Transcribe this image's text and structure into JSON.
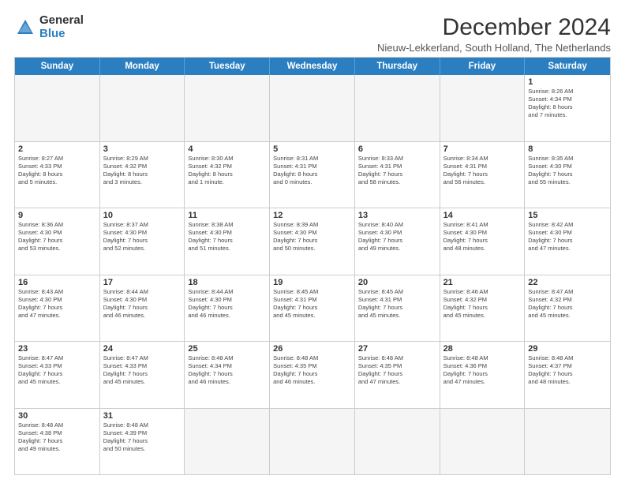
{
  "logo": {
    "general": "General",
    "blue": "Blue"
  },
  "title": "December 2024",
  "subtitle": "Nieuw-Lekkerland, South Holland, The Netherlands",
  "calendar": {
    "headers": [
      "Sunday",
      "Monday",
      "Tuesday",
      "Wednesday",
      "Thursday",
      "Friday",
      "Saturday"
    ],
    "weeks": [
      [
        {
          "day": "",
          "empty": true
        },
        {
          "day": "",
          "empty": true
        },
        {
          "day": "",
          "empty": true
        },
        {
          "day": "",
          "empty": true
        },
        {
          "day": "",
          "empty": true
        },
        {
          "day": "",
          "empty": true
        },
        {
          "day": "1",
          "text": "Sunrise: 8:26 AM\nSunset: 4:34 PM\nDaylight: 8 hours\nand 7 minutes."
        }
      ],
      [
        {
          "day": "2",
          "text": "Sunrise: 8:27 AM\nSunset: 4:33 PM\nDaylight: 8 hours\nand 5 minutes."
        },
        {
          "day": "3",
          "text": "Sunrise: 8:29 AM\nSunset: 4:32 PM\nDaylight: 8 hours\nand 3 minutes."
        },
        {
          "day": "4",
          "text": "Sunrise: 8:30 AM\nSunset: 4:32 PM\nDaylight: 8 hours\nand 1 minute."
        },
        {
          "day": "5",
          "text": "Sunrise: 8:31 AM\nSunset: 4:31 PM\nDaylight: 8 hours\nand 0 minutes."
        },
        {
          "day": "6",
          "text": "Sunrise: 8:33 AM\nSunset: 4:31 PM\nDaylight: 7 hours\nand 58 minutes."
        },
        {
          "day": "7",
          "text": "Sunrise: 8:34 AM\nSunset: 4:31 PM\nDaylight: 7 hours\nand 56 minutes."
        },
        {
          "day": "8",
          "text": "Sunrise: 8:35 AM\nSunset: 4:30 PM\nDaylight: 7 hours\nand 55 minutes."
        }
      ],
      [
        {
          "day": "9",
          "text": "Sunrise: 8:36 AM\nSunset: 4:30 PM\nDaylight: 7 hours\nand 53 minutes."
        },
        {
          "day": "10",
          "text": "Sunrise: 8:37 AM\nSunset: 4:30 PM\nDaylight: 7 hours\nand 52 minutes."
        },
        {
          "day": "11",
          "text": "Sunrise: 8:38 AM\nSunset: 4:30 PM\nDaylight: 7 hours\nand 51 minutes."
        },
        {
          "day": "12",
          "text": "Sunrise: 8:39 AM\nSunset: 4:30 PM\nDaylight: 7 hours\nand 50 minutes."
        },
        {
          "day": "13",
          "text": "Sunrise: 8:40 AM\nSunset: 4:30 PM\nDaylight: 7 hours\nand 49 minutes."
        },
        {
          "day": "14",
          "text": "Sunrise: 8:41 AM\nSunset: 4:30 PM\nDaylight: 7 hours\nand 48 minutes."
        },
        {
          "day": "15",
          "text": "Sunrise: 8:42 AM\nSunset: 4:30 PM\nDaylight: 7 hours\nand 47 minutes."
        }
      ],
      [
        {
          "day": "16",
          "text": "Sunrise: 8:43 AM\nSunset: 4:30 PM\nDaylight: 7 hours\nand 47 minutes."
        },
        {
          "day": "17",
          "text": "Sunrise: 8:44 AM\nSunset: 4:30 PM\nDaylight: 7 hours\nand 46 minutes."
        },
        {
          "day": "18",
          "text": "Sunrise: 8:44 AM\nSunset: 4:30 PM\nDaylight: 7 hours\nand 46 minutes."
        },
        {
          "day": "19",
          "text": "Sunrise: 8:45 AM\nSunset: 4:31 PM\nDaylight: 7 hours\nand 45 minutes."
        },
        {
          "day": "20",
          "text": "Sunrise: 8:45 AM\nSunset: 4:31 PM\nDaylight: 7 hours\nand 45 minutes."
        },
        {
          "day": "21",
          "text": "Sunrise: 8:46 AM\nSunset: 4:32 PM\nDaylight: 7 hours\nand 45 minutes."
        },
        {
          "day": "22",
          "text": "Sunrise: 8:47 AM\nSunset: 4:32 PM\nDaylight: 7 hours\nand 45 minutes."
        }
      ],
      [
        {
          "day": "23",
          "text": "Sunrise: 8:47 AM\nSunset: 4:33 PM\nDaylight: 7 hours\nand 45 minutes."
        },
        {
          "day": "24",
          "text": "Sunrise: 8:47 AM\nSunset: 4:33 PM\nDaylight: 7 hours\nand 45 minutes."
        },
        {
          "day": "25",
          "text": "Sunrise: 8:48 AM\nSunset: 4:34 PM\nDaylight: 7 hours\nand 46 minutes."
        },
        {
          "day": "26",
          "text": "Sunrise: 8:48 AM\nSunset: 4:35 PM\nDaylight: 7 hours\nand 46 minutes."
        },
        {
          "day": "27",
          "text": "Sunrise: 8:48 AM\nSunset: 4:35 PM\nDaylight: 7 hours\nand 47 minutes."
        },
        {
          "day": "28",
          "text": "Sunrise: 8:48 AM\nSunset: 4:36 PM\nDaylight: 7 hours\nand 47 minutes."
        },
        {
          "day": "29",
          "text": "Sunrise: 8:48 AM\nSunset: 4:37 PM\nDaylight: 7 hours\nand 48 minutes."
        }
      ],
      [
        {
          "day": "30",
          "text": "Sunrise: 8:48 AM\nSunset: 4:38 PM\nDaylight: 7 hours\nand 49 minutes."
        },
        {
          "day": "31",
          "text": "Sunrise: 8:48 AM\nSunset: 4:39 PM\nDaylight: 7 hours\nand 50 minutes."
        },
        {
          "day": "",
          "empty": true
        },
        {
          "day": "",
          "empty": true
        },
        {
          "day": "",
          "empty": true
        },
        {
          "day": "",
          "empty": true
        },
        {
          "day": "",
          "empty": true
        }
      ]
    ]
  }
}
